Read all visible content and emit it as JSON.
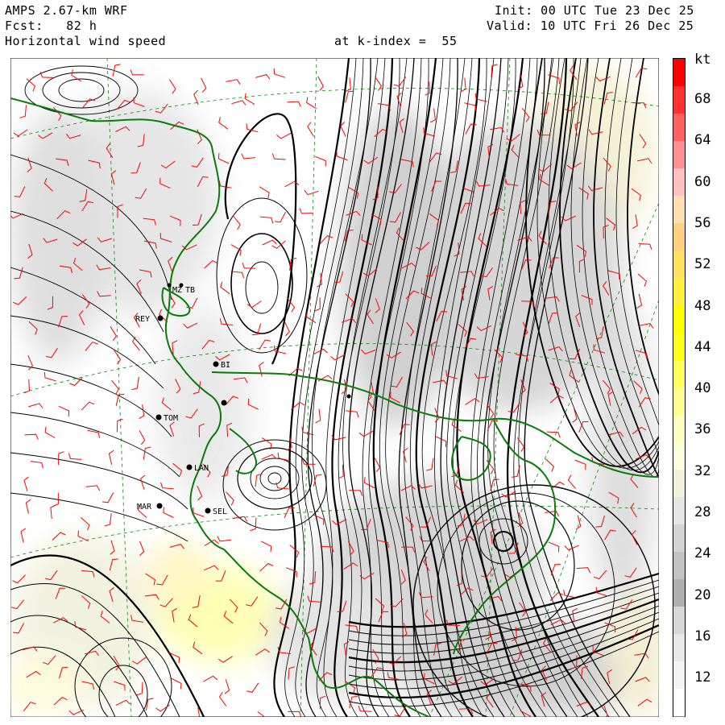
{
  "header": {
    "model": "AMPS 2.67-km WRF",
    "fcst_label": "Fcst:",
    "fcst_value": "82 h",
    "field": "Horizontal wind speed",
    "level": "at k-index =  55",
    "init": "Init: 00 UTC Tue 23 Dec 25",
    "valid": "Valid: 10 UTC Fri 26 Dec 25"
  },
  "colorbar": {
    "unit": "kt",
    "labels": [
      "68",
      "64",
      "60",
      "56",
      "52",
      "48",
      "44",
      "40",
      "36",
      "32",
      "28",
      "24",
      "20",
      "16",
      "12"
    ],
    "colors": [
      "#ff0000",
      "#ff3030",
      "#ff6060",
      "#ff9090",
      "#ffc0c0",
      "#ffe0b0",
      "#ffd080",
      "#ffe060",
      "#fff040",
      "#ffff00",
      "#ffff20",
      "#ffff60",
      "#ffff90",
      "#ffffc0",
      "#ffffe0",
      "#f2f2dc",
      "#e6e6e6",
      "#d4d4d4",
      "#c2c2c2",
      "#b0b0b0",
      "#d8d8d8",
      "#e8e8e8",
      "#f4f4f4",
      "#ffffff"
    ]
  },
  "stations": [
    {
      "code": "MZ",
      "label": "MZ"
    },
    {
      "code": "TB",
      "label": "TB"
    },
    {
      "code": "REY",
      "label": "REY"
    },
    {
      "code": "BI",
      "label": "BI"
    },
    {
      "code": "TOM",
      "label": "TOM"
    },
    {
      "code": "LAN",
      "label": "LAN"
    },
    {
      "code": "SEL",
      "label": "SEL"
    },
    {
      "code": "MAR",
      "label": "MAR"
    }
  ],
  "icons": [
    "wind-barb-icon",
    "station-dot-icon"
  ]
}
